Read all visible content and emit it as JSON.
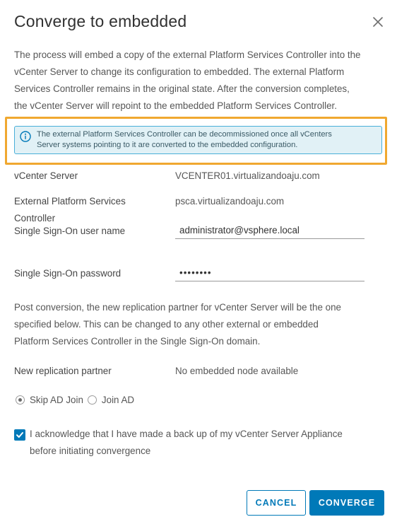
{
  "dialog": {
    "title": "Converge to embedded",
    "intro_lines": [
      "The process will embed a copy of the external Platform Services Controller into the",
      "vCenter Server to change its configuration to embedded. The external Platform",
      "Services Controller remains in the original state. After the conversion completes,",
      "the vCenter Server will repoint to the embedded Platform Services Controller."
    ],
    "alert": {
      "icon": "info-circle-icon",
      "lines": [
        "The external Platform Services Controller can be decommissioned once all vCenters",
        "Server systems pointing to it are converted to the embedded configuration."
      ]
    },
    "fields": {
      "vcenter_label": "vCenter Server",
      "vcenter_value": "VCENTER01.virtualizandoaju.com",
      "psc_label_line1": "External Platform Services",
      "psc_label_line2": "Controller",
      "psc_value": "psca.virtualizandoaju.com",
      "sso_user_label": "Single Sign-On user name",
      "sso_user_value": "administrator@vsphere.local",
      "sso_password_label": "Single Sign-On password",
      "sso_password_value": "••••••••"
    },
    "post_lines": [
      "Post conversion, the new replication partner for vCenter Server will be the one",
      "specified below. This can be changed to any other external or embedded",
      "Platform Services Controller in the Single Sign-On domain."
    ],
    "replication": {
      "label": "New replication partner",
      "value": "No embedded node available"
    },
    "ad_options": {
      "skip_label": "Skip AD Join",
      "join_label": "Join AD",
      "selected": "skip"
    },
    "acknowledge": {
      "checked": true,
      "line1": "I acknowledge that I have made a back up of my vCenter Server Appliance",
      "line2": "before initiating convergence"
    },
    "buttons": {
      "cancel": "CANCEL",
      "converge": "CONVERGE"
    },
    "colors": {
      "primary": "#0079b8",
      "highlight": "#f0a830",
      "alert_bg": "#e1f1f6",
      "alert_border": "#49afd9"
    }
  }
}
